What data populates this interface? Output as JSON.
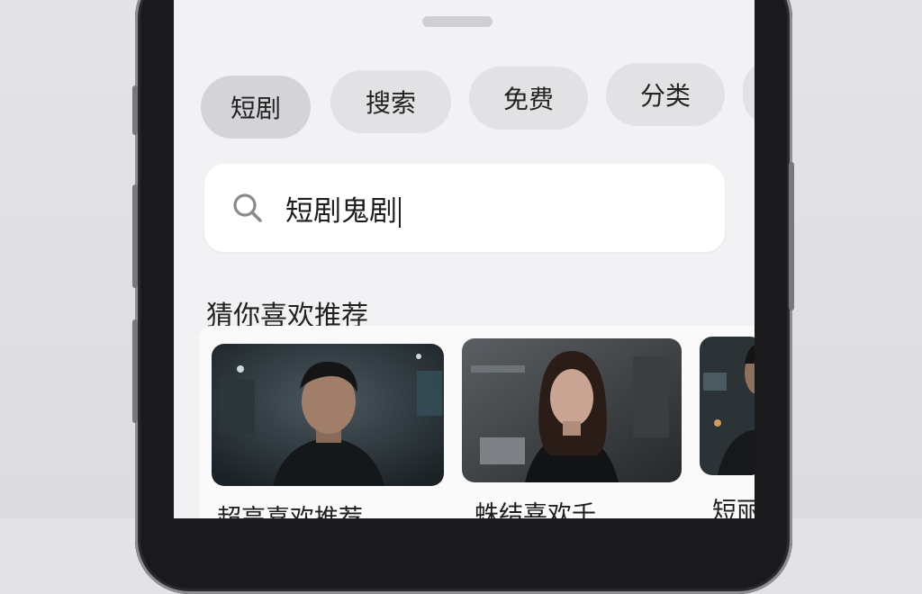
{
  "chips": [
    {
      "label": "短剧",
      "active": true
    },
    {
      "label": "搜索",
      "active": false
    },
    {
      "label": "免费",
      "active": false
    },
    {
      "label": "分类",
      "active": false
    }
  ],
  "search": {
    "icon": "search-icon",
    "value": "短剧鬼剧"
  },
  "recommend": {
    "title": "猜你喜欢推荐",
    "cards": [
      {
        "caption": "超高喜欢推荐",
        "thumb": "man-in-dark-room"
      },
      {
        "caption": "蛛结喜欢千",
        "thumb": "woman-in-dark-room"
      },
      {
        "caption": "短丽影",
        "thumb": "man-partial"
      }
    ]
  },
  "colors": {
    "screen_bg": "#f2f2f4",
    "chip_bg": "#e2e2e5",
    "chip_active_bg": "#d4d4d8",
    "search_bg": "#ffffff"
  }
}
